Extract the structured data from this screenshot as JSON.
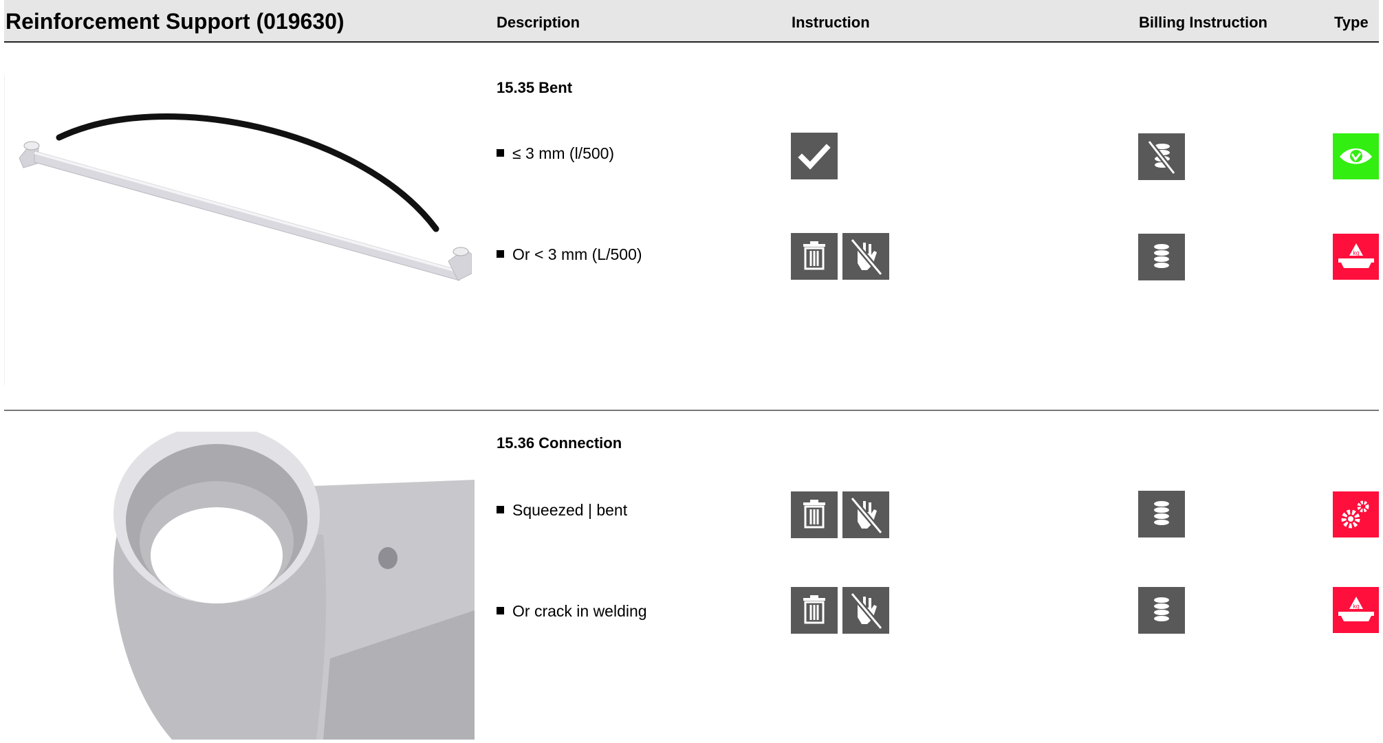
{
  "header": {
    "title": "Reinforcement Support (019630)",
    "col_description": "Description",
    "col_instruction": "Instruction",
    "col_billing": "Billing Instruction",
    "col_type": "Type"
  },
  "sections": [
    {
      "title": "15.35 Bent",
      "rows": [
        {
          "text": "≤ 3 mm (l/500)",
          "instruction_icons": [
            "check-icon"
          ],
          "billing_icon": "no-billing-coins-icon",
          "type_icon": "eye-icon",
          "type_color": "#33ee11"
        },
        {
          "text": "Or < 3 mm (L/500)",
          "instruction_icons": [
            "trash-icon",
            "no-hand-icon"
          ],
          "billing_icon": "coins-icon",
          "type_icon": "weight-kg-icon",
          "type_color": "#ff0f3c"
        }
      ]
    },
    {
      "title": "15.36 Connection",
      "rows": [
        {
          "text": "Squeezed | bent",
          "instruction_icons": [
            "trash-icon",
            "no-hand-icon"
          ],
          "billing_icon": "coins-icon",
          "type_icon": "gears-icon",
          "type_color": "#ff0f3c"
        },
        {
          "text": "Or crack in welding",
          "instruction_icons": [
            "trash-icon",
            "no-hand-icon"
          ],
          "billing_icon": "coins-icon",
          "type_icon": "weight-kg-icon",
          "type_color": "#ff0f3c"
        }
      ]
    }
  ],
  "weight_icon_label": "kg"
}
